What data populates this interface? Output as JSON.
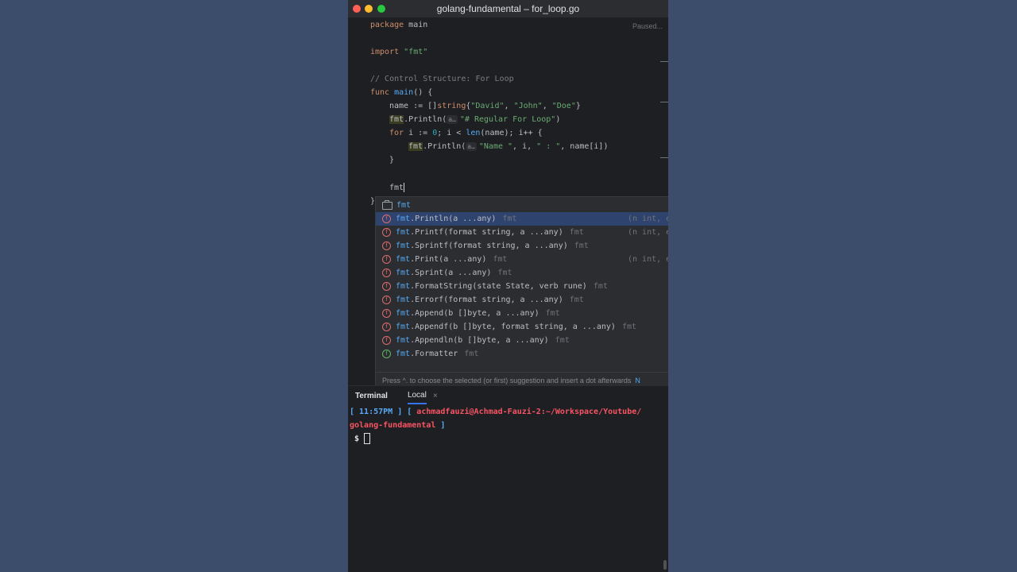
{
  "window": {
    "title": "golang-fundamental – for_loop.go",
    "status": "Paused..."
  },
  "code": {
    "l1_kw": "package",
    "l1_rest": " main",
    "l2_kw": "import",
    "l2_str": "\"fmt\"",
    "l3": "// Control Structure: For Loop",
    "l4_kw": "func",
    "l4_fn": "main",
    "l4_rest": "() {",
    "l5_a": "name := []",
    "l5_type": "string",
    "l5_b": "{",
    "l5_s1": "\"David\"",
    "l5_c1": ", ",
    "l5_s2": "\"John\"",
    "l5_c2": ", ",
    "l5_s3": "\"Doe\"",
    "l5_end": "}",
    "l6_pkg": "fmt",
    "l6_call": ".Println(",
    "l6_hint": "a…",
    "l6_str": "\"# Regular For Loop\"",
    "l6_end": ")",
    "l7_kw": "for",
    "l7_a": " i := ",
    "l7_n": "0",
    "l7_b": "; i < ",
    "l7_fn": "len",
    "l7_c": "(name); i++ {",
    "l8_pkg": "fmt",
    "l8_call": ".Println(",
    "l8_hint": "a…",
    "l8_str": "\"Name \"",
    "l8_mid": ", i, ",
    "l8_str2": "\" : \"",
    "l8_end": ", name[i])",
    "l9": "}",
    "l10": "fmt",
    "l11": "}"
  },
  "completion": {
    "package_item": "fmt",
    "items": [
      {
        "prefix": "fmt",
        "sig": ".Println(a ...any)",
        "pkg": "fmt",
        "tail": "(n int, e"
      },
      {
        "prefix": "fmt",
        "sig": ".Printf(format string, a ...any)",
        "pkg": "fmt",
        "tail": "(n int, e"
      },
      {
        "prefix": "fmt",
        "sig": ".Sprintf(format string, a ...any)",
        "pkg": "fmt",
        "tail": ""
      },
      {
        "prefix": "fmt",
        "sig": ".Print(a ...any)",
        "pkg": "fmt",
        "tail": "(n int, e"
      },
      {
        "prefix": "fmt",
        "sig": ".Sprint(a ...any)",
        "pkg": "fmt",
        "tail": ""
      },
      {
        "prefix": "fmt",
        "sig": ".FormatString(state State, verb rune)",
        "pkg": "fmt",
        "tail": ""
      },
      {
        "prefix": "fmt",
        "sig": ".Errorf(format string, a ...any)",
        "pkg": "fmt",
        "tail": ""
      },
      {
        "prefix": "fmt",
        "sig": ".Append(b []byte, a ...any)",
        "pkg": "fmt",
        "tail": ""
      },
      {
        "prefix": "fmt",
        "sig": ".Appendf(b []byte, format string, a ...any)",
        "pkg": "fmt",
        "tail": ""
      },
      {
        "prefix": "fmt",
        "sig": ".Appendln(b []byte, a ...any)",
        "pkg": "fmt",
        "tail": ""
      },
      {
        "prefix": "fmt",
        "sig": ".Formatter",
        "pkg": "fmt",
        "tail": ""
      }
    ],
    "footer": "Press ^. to choose the selected (or first) suggestion and insert a dot afterwards",
    "footer_link": "N"
  },
  "terminal": {
    "title": "Terminal",
    "tab": "Local",
    "close": "×",
    "line1_time": "[ 11:57PM ]",
    "line1_open": " [ ",
    "line1_path": "achmadfauzi@Achmad-Fauzi-2:~/Workspace/Youtube/",
    "line2_path": "golang-fundamental",
    "line2_close": " ]",
    "prompt": " $ "
  }
}
